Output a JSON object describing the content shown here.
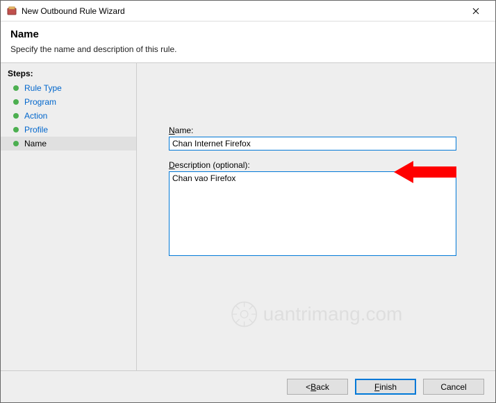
{
  "titlebar": {
    "title": "New Outbound Rule Wizard"
  },
  "header": {
    "title": "Name",
    "subtitle": "Specify the name and description of this rule."
  },
  "sidebar": {
    "steps_label": "Steps:",
    "items": [
      {
        "label": "Rule Type",
        "active": false
      },
      {
        "label": "Program",
        "active": false
      },
      {
        "label": "Action",
        "active": false
      },
      {
        "label": "Profile",
        "active": false
      },
      {
        "label": "Name",
        "active": true
      }
    ]
  },
  "form": {
    "name_label": "Name:",
    "name_value": "Chan Internet Firefox",
    "desc_label": "Description (optional):",
    "desc_value": "Chan vao Firefox"
  },
  "footer": {
    "back": "Back",
    "finish": "Finish",
    "cancel": "Cancel"
  },
  "watermark": "uantrimang.com"
}
